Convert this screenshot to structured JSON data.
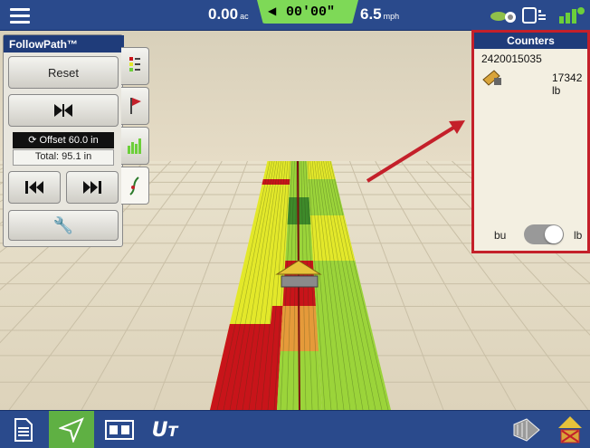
{
  "topbar": {
    "area_value": "0.00",
    "area_unit": "ac",
    "time_value": "00'00\"",
    "speed_value": "6.5",
    "speed_unit": "mph"
  },
  "followpath": {
    "title": "FollowPath™",
    "reset_label": "Reset",
    "offset_text": "Offset 60.0 in",
    "total_text": "Total: 95.1 in"
  },
  "counters": {
    "title": "Counters",
    "counter_id": "2420015035",
    "counter_value": "17342 lb",
    "unit_left": "bu",
    "unit_right": "lb",
    "toggle_state": "lb"
  },
  "colors": {
    "topbar_bg": "#2a4a8c",
    "panel_title_bg": "#1f3c7a",
    "active_nav": "#5fb043",
    "highlight_border": "#c4202a",
    "time_badge": "#7ed957",
    "pass_yellow": "#e3e82a",
    "pass_green": "#9bd43a",
    "pass_red": "#c8141a",
    "pass_orange": "#e59a3a"
  },
  "bottombar": {
    "buttons": [
      "document-icon",
      "navigation-icon",
      "split-view-icon",
      "ut-icon",
      "field-boundary-icon",
      "warning-icon"
    ]
  }
}
